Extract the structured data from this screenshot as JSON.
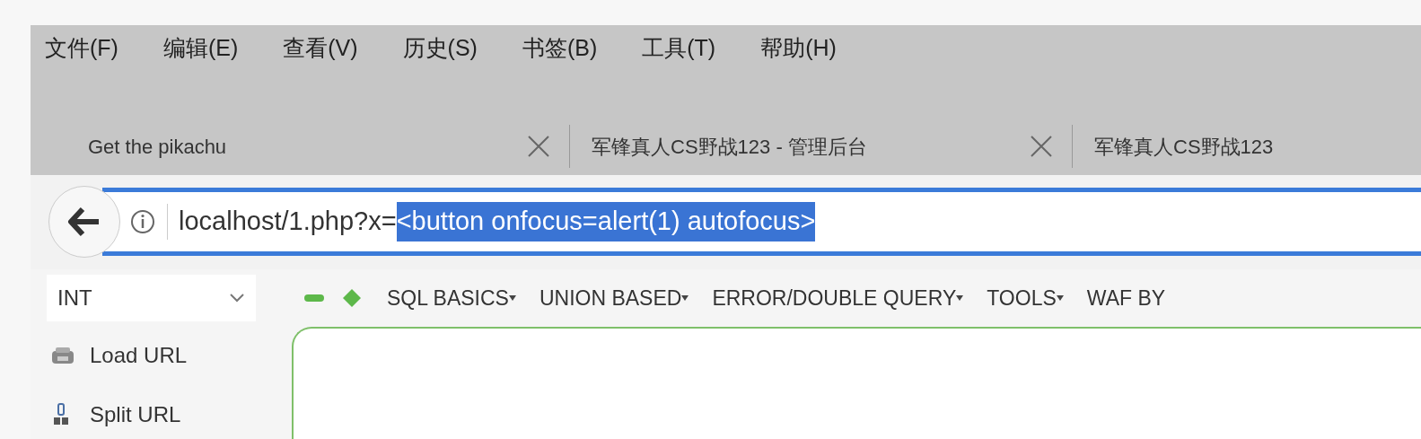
{
  "menu_bar": [
    "文件(F)",
    "编辑(E)",
    "查看(V)",
    "历史(S)",
    "书签(B)",
    "工具(T)",
    "帮助(H)"
  ],
  "tabs": [
    {
      "title": "Get the pikachu",
      "closable": true
    },
    {
      "title": "军锋真人CS野战123 - 管理后台",
      "closable": true
    },
    {
      "title": "军锋真人CS野战123",
      "closable": false
    }
  ],
  "address_bar": {
    "url": "localhost/1.php?x=",
    "selected_text": "<button onfocus=alert(1) autofocus>"
  },
  "hackbar": {
    "select": {
      "value": "INT"
    },
    "menus": [
      {
        "label": "SQL BASICS",
        "has_dropdown": true
      },
      {
        "label": "UNION BASED",
        "has_dropdown": true
      },
      {
        "label": "ERROR/DOUBLE QUERY",
        "has_dropdown": true
      },
      {
        "label": "TOOLS",
        "has_dropdown": true
      },
      {
        "label": "WAF BY",
        "has_dropdown": false
      }
    ],
    "actions": [
      {
        "label": "Load URL",
        "kind": "load"
      },
      {
        "label": "Split URL",
        "kind": "split"
      }
    ]
  }
}
